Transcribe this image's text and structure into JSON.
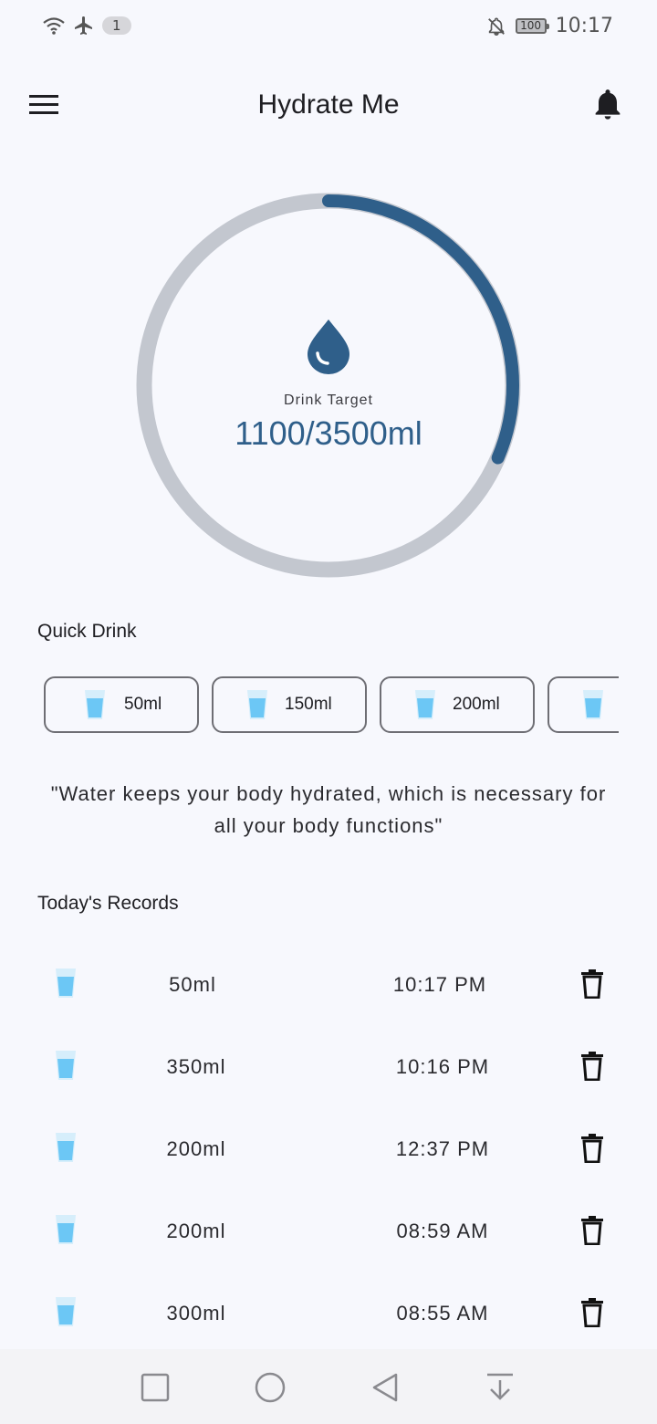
{
  "status_bar": {
    "notification_count": "1",
    "battery": "100",
    "time": "10:17"
  },
  "app_bar": {
    "title": "Hydrate Me"
  },
  "progress": {
    "label": "Drink Target",
    "value_text": "1100/3500ml",
    "fraction": 0.3143,
    "track_color": "#c3c7cf",
    "fill_color": "#2f5f8a"
  },
  "quick_drink": {
    "title": "Quick Drink",
    "options": [
      {
        "label": "50ml"
      },
      {
        "label": "150ml"
      },
      {
        "label": "200ml"
      },
      {
        "label": ""
      }
    ]
  },
  "quote": "\"Water keeps your body hydrated, which is necessary for all your body functions\"",
  "records": {
    "title": "Today's Records",
    "items": [
      {
        "amount": "50ml",
        "time": "10:17 PM"
      },
      {
        "amount": "350ml",
        "time": "10:16 PM"
      },
      {
        "amount": "200ml",
        "time": "12:37 PM"
      },
      {
        "amount": "200ml",
        "time": "08:59 AM"
      },
      {
        "amount": "300ml",
        "time": "08:55 AM"
      }
    ]
  },
  "icons": {
    "menu": "menu-icon",
    "bell": "bell-icon",
    "drop": "water-drop-icon",
    "glass": "water-glass-icon",
    "trash": "trash-icon"
  }
}
